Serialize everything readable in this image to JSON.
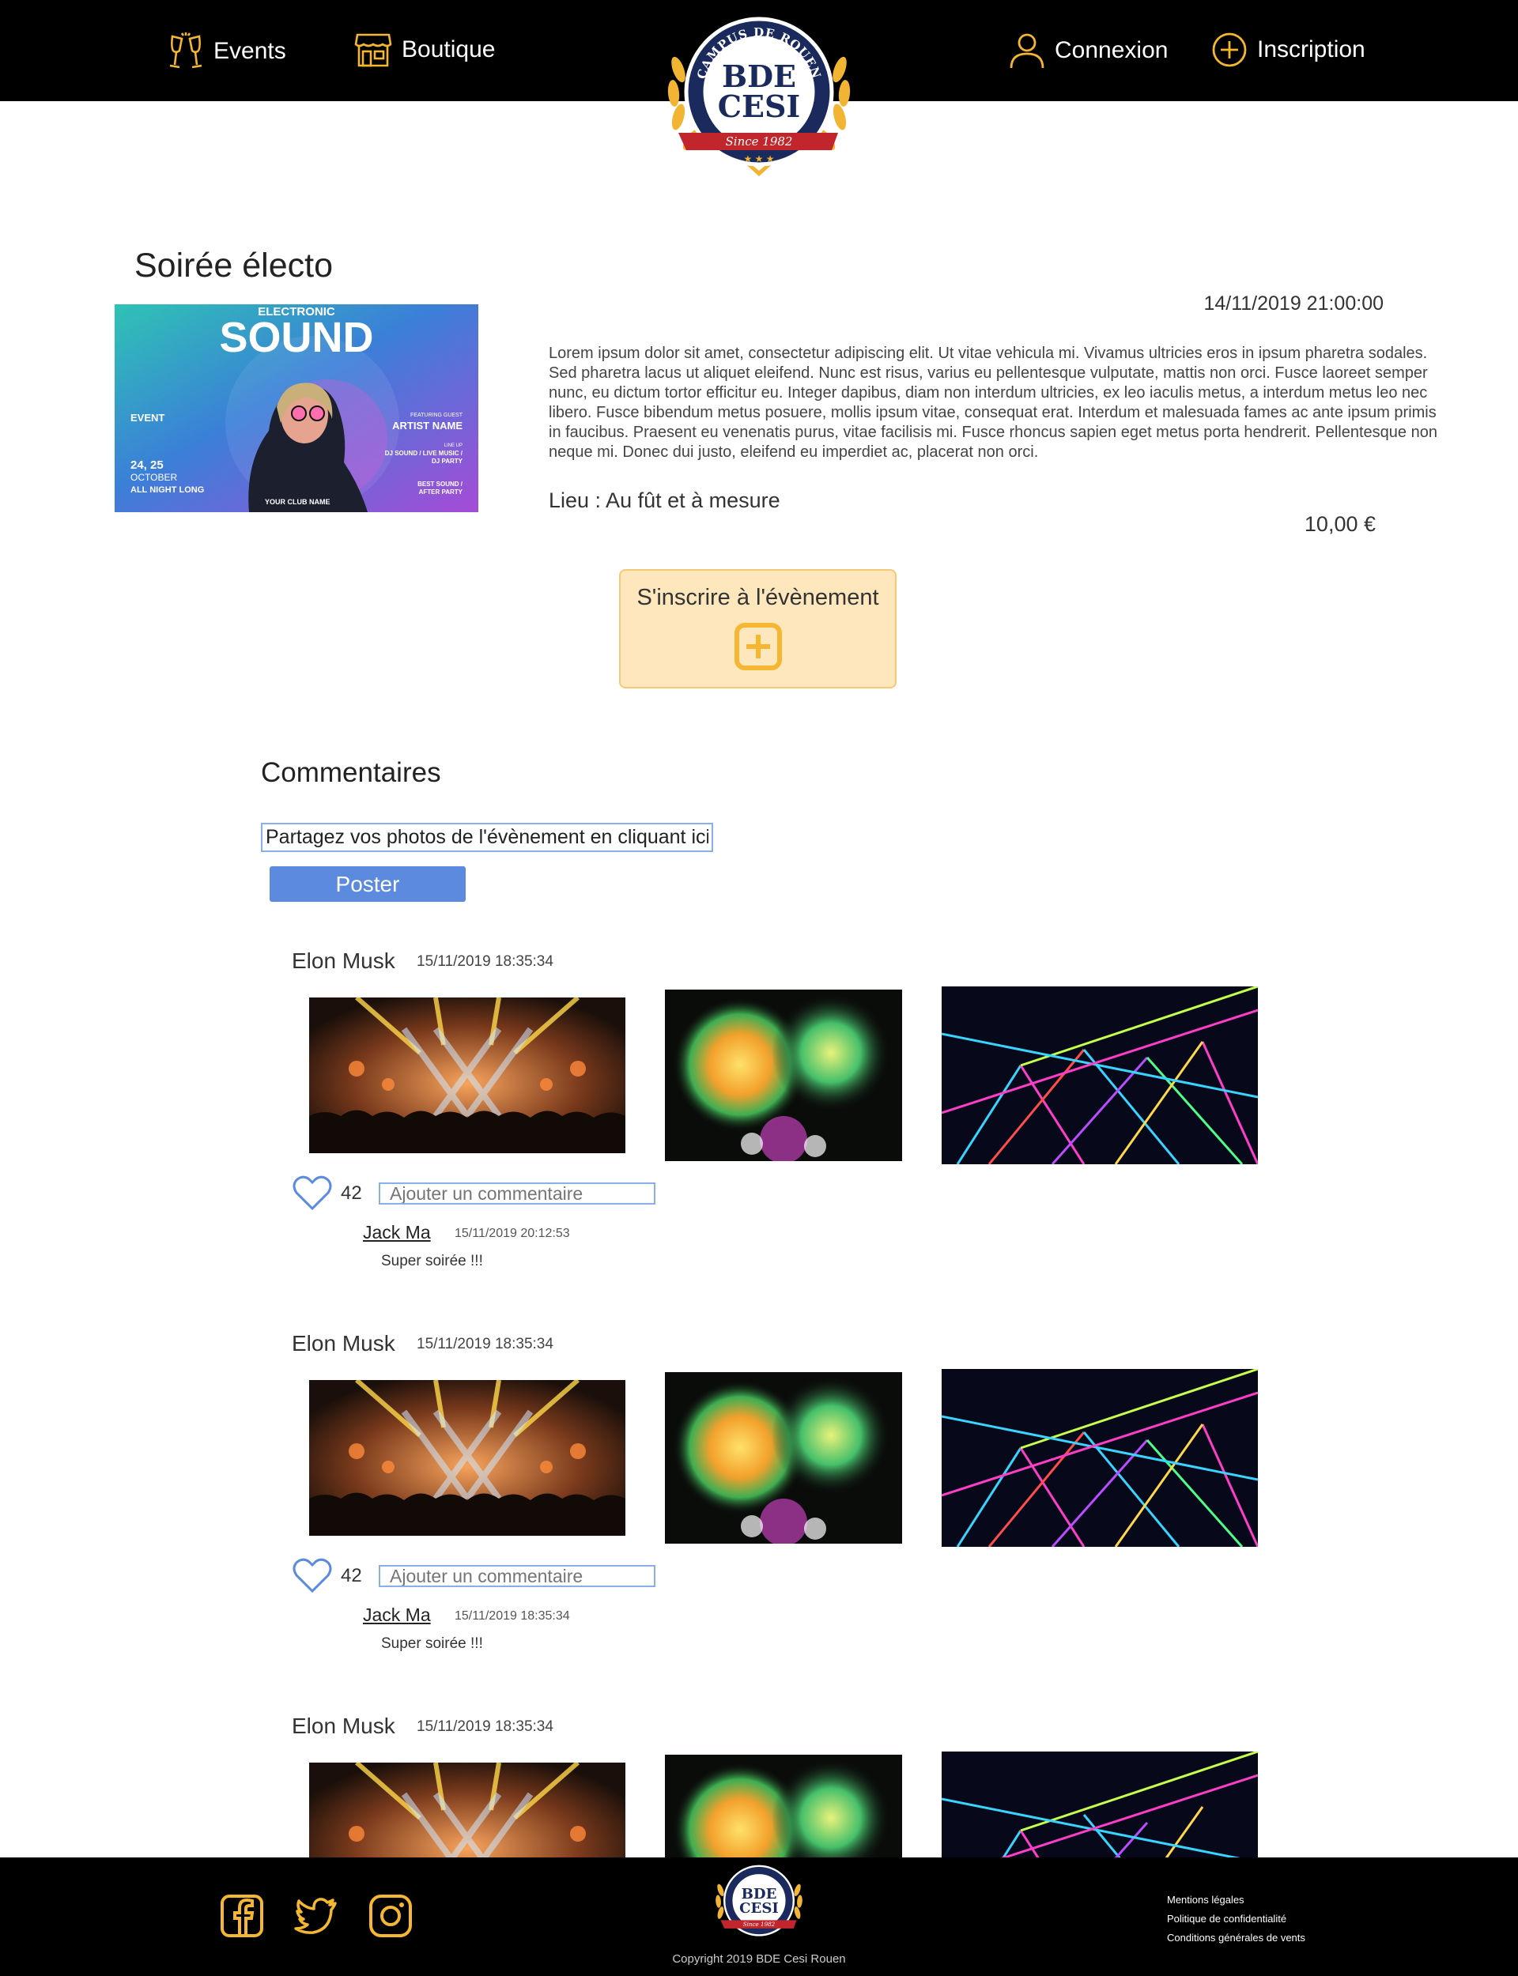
{
  "header": {
    "nav": {
      "events": "Events",
      "boutique": "Boutique",
      "connexion": "Connexion",
      "inscription": "Inscription"
    },
    "logo": {
      "arc_text": "CAMPUS DE ROUEN",
      "line1": "BDE",
      "line2": "CESI",
      "ribbon": "Since 1982"
    }
  },
  "event": {
    "title": "Soirée électo",
    "date": "14/11/2019 21:00:00",
    "description": "Lorem ipsum dolor sit amet, consectetur adipiscing elit. Ut vitae vehicula mi. Vivamus ultricies eros in ipsum pharetra sodales. Sed pharetra lacus ut aliquet eleifend. Nunc est risus, varius eu pellentesque vulputate, mattis non orci. Fusce laoreet semper nunc, eu dictum tortor efficitur eu. Integer dapibus, diam non interdum ultricies, ex leo iaculis metus, a interdum metus leo nec libero. Fusce bibendum metus posuere, mollis ipsum vitae, consequat erat. Interdum et malesuada fames ac ante ipsum primis in faucibus. Praesent eu venenatis purus, vitae facilisis mi. Fusce rhoncus sapien eget metus porta hendrerit. Pellentesque non neque mi. Donec dui justo, eleifend eu imperdiet ac, placerat non orci.",
    "place": "Lieu : Au fût et à mesure",
    "price": "10,00 €",
    "register_label": "S'inscrire à l'évènement",
    "poster": {
      "top": "ELECTRONIC",
      "big": "SOUND",
      "event": "EVENT",
      "dates": "24, 25",
      "month": "OCTOBER",
      "night": "ALL NIGHT LONG",
      "artist_small": "FEATURING GUEST",
      "artist": "ARTIST NAME",
      "line_up": "LINE UP",
      "line1": "DJ SOUND / LIVE MUSIC /",
      "line2": "DJ PARTY",
      "best": "BEST SOUND /",
      "after": "AFTER PARTY",
      "club": "YOUR CLUB NAME"
    }
  },
  "comments": {
    "title": "Commentaires",
    "share_value": "Partagez vos photos de l'évènement en cliquant ici !",
    "post_label": "Poster"
  },
  "posts": [
    {
      "author": "Elon Musk",
      "date": "15/11/2019 18:35:34",
      "likes": "42",
      "comment_placeholder": "Ajouter un commentaire",
      "comment": {
        "author": "Jack Ma",
        "date": "15/11/2019 20:12:53",
        "text": "Super soirée !!!"
      }
    },
    {
      "author": "Elon Musk",
      "date": "15/11/2019 18:35:34",
      "likes": "42",
      "comment_placeholder": "Ajouter un commentaire",
      "comment": {
        "author": "Jack Ma",
        "date": "15/11/2019 18:35:34",
        "text": "Super soirée !!!"
      }
    },
    {
      "author": "Elon Musk",
      "date": "15/11/2019 18:35:34"
    }
  ],
  "footer": {
    "social": [
      "facebook-icon",
      "twitter-icon",
      "instagram-icon"
    ],
    "copyright": "Copyright 2019 BDE Cesi Rouen",
    "links": [
      "Mentions légales",
      "Politique de confidentialité",
      "Conditions générales de vents"
    ]
  },
  "colors": {
    "accent": "#f5b731",
    "header_bg": "#000000",
    "button_blue": "#5b8ade",
    "register_bg": "#ffe7bd"
  }
}
